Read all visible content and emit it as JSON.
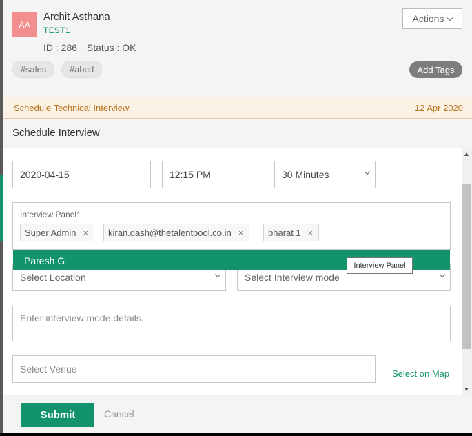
{
  "candidate": {
    "initials": "AA",
    "name": "Archit Asthana",
    "company": "TEST1",
    "id_text": "ID : 286",
    "status_text": "Status : OK"
  },
  "header": {
    "actions_label": "Actions",
    "tags": [
      "#sales",
      "#abcd"
    ],
    "add_tags_label": "Add Tags"
  },
  "schedule_bar": {
    "title": "Schedule Technical Interview",
    "date": "12 Apr 2020"
  },
  "form": {
    "title": "Schedule Interview",
    "date_value": "2020-04-15",
    "time_value": "12:15 PM",
    "duration_value": "30 Minutes",
    "panel_label": "Interview Panel",
    "panel_required": "*",
    "panel_members": [
      "Super Admin",
      "kiran.dash@thetalentpool.co.in",
      "bharat 1"
    ],
    "remove_symbol": "×",
    "dropdown_suggestion": "Paresh G",
    "tooltip_text": "Interview Panel",
    "location_placeholder": "Select Location",
    "mode_placeholder": "Select Interview mode",
    "details_placeholder": "Enter interview mode details.",
    "venue_placeholder": "Select Venue",
    "map_link": "Select on Map"
  },
  "footer": {
    "submit_label": "Submit",
    "cancel_label": "Cancel"
  },
  "colors": {
    "accent": "#12936d",
    "avatar_bg": "#f38e8e",
    "schedule_text": "#b8731c"
  }
}
